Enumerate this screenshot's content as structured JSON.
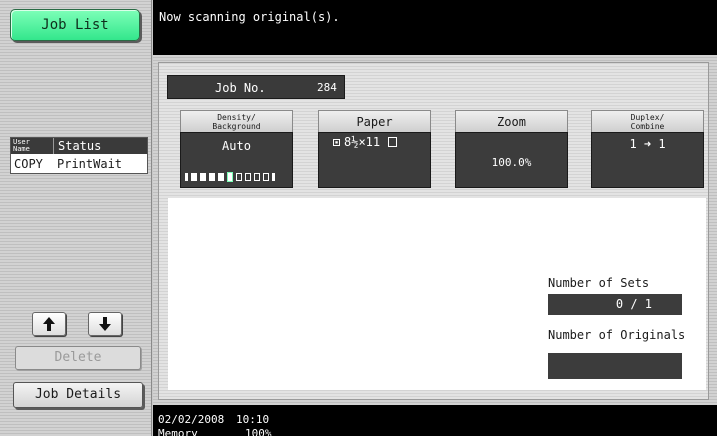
{
  "sidebar": {
    "job_list_label": "Job List",
    "table": {
      "col_user_name": "User\nName",
      "col_status": "Status",
      "rows": [
        {
          "user": "COPY",
          "status": "PrintWait"
        }
      ]
    },
    "delete_label": "Delete",
    "job_details_label": "Job Details"
  },
  "message": "Now scanning original(s).",
  "job": {
    "label": "Job No.",
    "number": "284"
  },
  "settings": {
    "density": {
      "label": "Density/\nBackground",
      "value": "Auto",
      "level": 5,
      "levels": 9
    },
    "paper": {
      "label": "Paper",
      "value": "8½×11"
    },
    "zoom": {
      "label": "Zoom",
      "value": "100.0%"
    },
    "duplex": {
      "label": "Duplex/\nCombine",
      "value": "1 ➜ 1"
    }
  },
  "counts": {
    "sets_label": "Number of Sets",
    "sets_value": "0 / 1",
    "originals_label": "Number of Originals",
    "originals_value": ""
  },
  "status_bar": {
    "date": "02/02/2008",
    "time": "10:10",
    "memory_label": "Memory",
    "memory_value": "100%"
  },
  "colors": {
    "accent_green": "#33e68c",
    "dark_panel": "#3c3c3c"
  }
}
